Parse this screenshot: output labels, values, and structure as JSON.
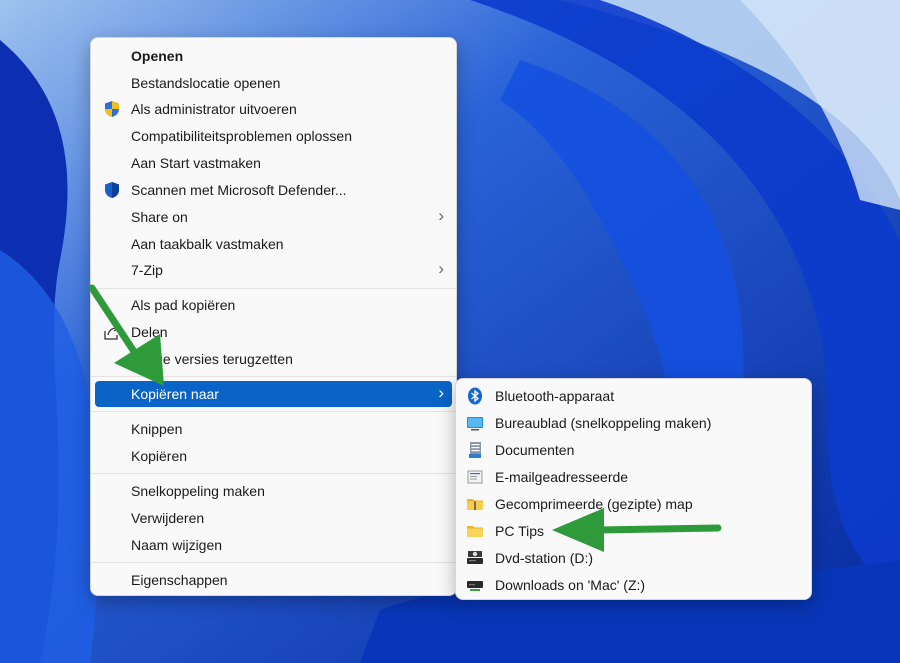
{
  "main_menu": {
    "items": [
      {
        "label": "Openen"
      },
      {
        "label": "Bestandslocatie openen"
      },
      {
        "label": "Als administrator uitvoeren"
      },
      {
        "label": "Compatibiliteitsproblemen oplossen"
      },
      {
        "label": "Aan Start vastmaken"
      },
      {
        "label": "Scannen met Microsoft Defender..."
      },
      {
        "label": "Share on"
      },
      {
        "label": "Aan taakbalk vastmaken"
      },
      {
        "label": "7-Zip"
      },
      {
        "label": "Als pad kopiëren"
      },
      {
        "label": "Delen"
      },
      {
        "label": "Vorige versies terugzetten"
      },
      {
        "label": "Kopiëren naar"
      },
      {
        "label": "Knippen"
      },
      {
        "label": "Kopiëren"
      },
      {
        "label": "Snelkoppeling maken"
      },
      {
        "label": "Verwijderen"
      },
      {
        "label": "Naam wijzigen"
      },
      {
        "label": "Eigenschappen"
      }
    ]
  },
  "submenu": {
    "items": [
      {
        "label": "Bluetooth-apparaat",
        "icon": "bluetooth-icon"
      },
      {
        "label": "Bureaublad (snelkoppeling maken)",
        "icon": "desktop-icon"
      },
      {
        "label": "Documenten",
        "icon": "documents-icon"
      },
      {
        "label": "E-mailgeadresseerde",
        "icon": "mail-recipient-icon"
      },
      {
        "label": "Gecomprimeerde (gezipte) map",
        "icon": "zip-folder-icon"
      },
      {
        "label": "PC Tips",
        "icon": "folder-icon"
      },
      {
        "label": "Dvd-station (D:)",
        "icon": "dvd-drive-icon"
      },
      {
        "label": "Downloads on 'Mac' (Z:)",
        "icon": "network-drive-icon"
      }
    ]
  },
  "colors": {
    "highlight": "#0a64c8",
    "arrow": "#2e9a3a",
    "wallpaper": "#0a3fc6"
  }
}
